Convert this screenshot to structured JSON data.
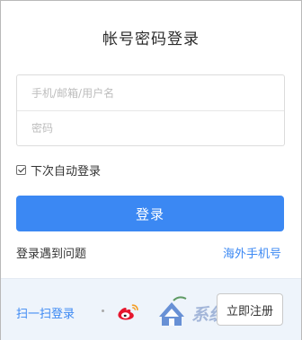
{
  "title": "帐号密码登录",
  "form": {
    "username_placeholder": "手机/邮箱/用户名",
    "password_placeholder": "密码",
    "remember_label": "下次自动登录",
    "remember_checked": true
  },
  "actions": {
    "login_label": "登录",
    "trouble_label": "登录遇到问题",
    "overseas_label": "海外手机号"
  },
  "footer": {
    "scan_label": "扫一扫登录",
    "weibo_icon": "weibo-icon",
    "register_label": "立即注册",
    "watermark_text": "系统之家"
  },
  "colors": {
    "accent": "#3b88f3",
    "weibo_red": "#e6162d",
    "weibo_orange": "#f49c21"
  }
}
